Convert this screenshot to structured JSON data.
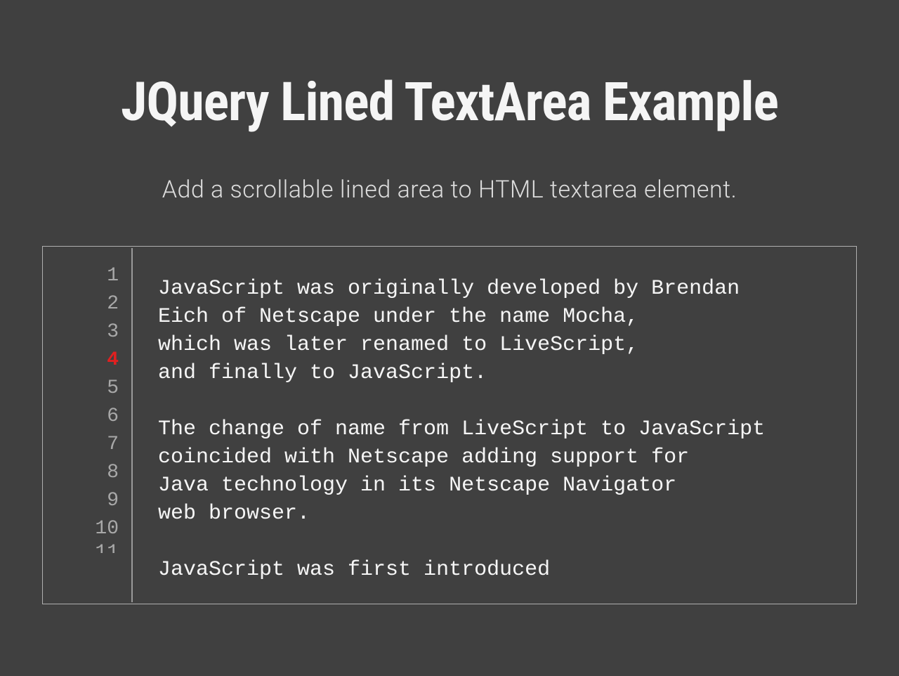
{
  "title": "JQuery Lined TextArea Example",
  "subtitle": "Add a scrollable lined area to HTML textarea element.",
  "gutter": {
    "lines": [
      "1",
      "2",
      "3",
      "4",
      "5",
      "6",
      "7",
      "8",
      "9",
      "10"
    ],
    "partial": "11",
    "selected_index": 3
  },
  "textarea": {
    "content": "JavaScript was originally developed by Brendan\nEich of Netscape under the name Mocha,\nwhich was later renamed to LiveScript,\nand finally to JavaScript.\n\nThe change of name from LiveScript to JavaScript\ncoincided with Netscape adding support for\nJava technology in its Netscape Navigator\nweb browser.\n\nJavaScript was first introduced"
  }
}
